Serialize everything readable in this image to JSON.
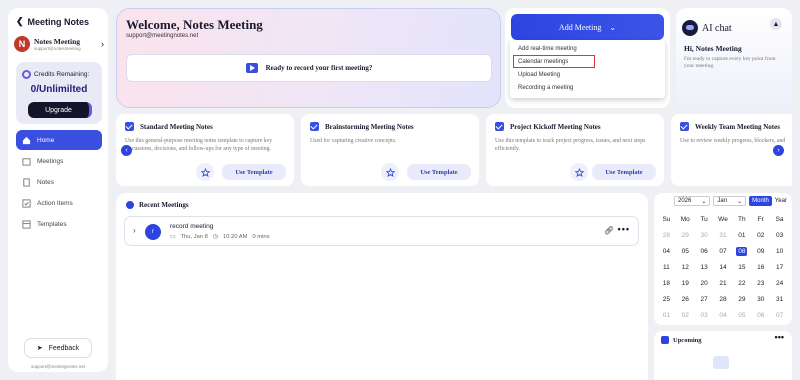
{
  "sidebar": {
    "title": "Meeting Notes",
    "user": {
      "initial": "N",
      "name": "Notes Meeting",
      "email": "support@notesmeeting"
    },
    "credits_label": "Credits Remaining:",
    "credits_value": "0/Unlimilted",
    "upgrade_label": "Upgrade",
    "nav": [
      {
        "label": "Home",
        "icon": "home-icon",
        "active": true
      },
      {
        "label": "Meetings",
        "icon": "calendar-icon",
        "active": false
      },
      {
        "label": "Notes",
        "icon": "notes-icon",
        "active": false
      },
      {
        "label": "Action Items",
        "icon": "checklist-icon",
        "active": false
      },
      {
        "label": "Templates",
        "icon": "templates-icon",
        "active": false
      }
    ],
    "feedback_label": "Feedback",
    "footer_email": "support@meetingnotes.net"
  },
  "welcome": {
    "title": "Welcome, Notes Meeting",
    "email": "support@meetingnotes.net",
    "record_prompt": "Ready to record your first meeting?"
  },
  "add_meeting": {
    "label": "Add Meeting",
    "menu": [
      "Add real-time meeting",
      "Calendar meetings",
      "Upload Meeting",
      "Recording a meeting"
    ],
    "highlighted_index": 1
  },
  "ai_chat": {
    "title": "AI chat",
    "greeting": "Hi, Notes Meeting",
    "description": "I'm ready to capture every key point from your meeting."
  },
  "templates": [
    {
      "title": "Standard Meeting Notes",
      "desc": "Use this general-purpose meeting notes template to capture key discussions, decisions, and follow-ups for any type of meeting.",
      "use": "Use Template"
    },
    {
      "title": "Brainstorming Meeting Notes",
      "desc": "Used for capturing creative concepts.",
      "use": "Use Template"
    },
    {
      "title": "Project Kickoff Meeting Notes",
      "desc": "Use this template to track project progress, issues, and next steps efficiently.",
      "use": "Use Template"
    },
    {
      "title": "Weekly Team Meeting Notes",
      "desc": "Use to review weekly progress, blockers, and",
      "use": "Use Template"
    }
  ],
  "recent": {
    "title": "Recent Meetings",
    "meetings": [
      {
        "avatar": "r",
        "title": "record meeting",
        "date": "Thu, Jan 8",
        "time": "10:20 AM",
        "duration": "0 mins"
      }
    ]
  },
  "calendar": {
    "year": "2026",
    "month": "Jan",
    "view_month": "Month",
    "view_year": "Year",
    "weekdays": [
      "Su",
      "Mo",
      "Tu",
      "We",
      "Th",
      "Fr",
      "Sa"
    ],
    "days": [
      {
        "d": "28",
        "o": true
      },
      {
        "d": "29",
        "o": true
      },
      {
        "d": "30",
        "o": true
      },
      {
        "d": "31",
        "o": true
      },
      {
        "d": "01"
      },
      {
        "d": "02"
      },
      {
        "d": "03"
      },
      {
        "d": "04"
      },
      {
        "d": "05"
      },
      {
        "d": "06"
      },
      {
        "d": "07"
      },
      {
        "d": "08",
        "t": true
      },
      {
        "d": "09"
      },
      {
        "d": "10"
      },
      {
        "d": "11"
      },
      {
        "d": "12"
      },
      {
        "d": "13"
      },
      {
        "d": "14"
      },
      {
        "d": "15"
      },
      {
        "d": "16"
      },
      {
        "d": "17"
      },
      {
        "d": "18"
      },
      {
        "d": "19"
      },
      {
        "d": "20"
      },
      {
        "d": "21"
      },
      {
        "d": "22"
      },
      {
        "d": "23"
      },
      {
        "d": "24"
      },
      {
        "d": "25"
      },
      {
        "d": "26"
      },
      {
        "d": "27"
      },
      {
        "d": "28"
      },
      {
        "d": "29"
      },
      {
        "d": "30"
      },
      {
        "d": "31"
      },
      {
        "d": "01",
        "o": true
      },
      {
        "d": "02",
        "o": true
      },
      {
        "d": "03",
        "o": true
      },
      {
        "d": "04",
        "o": true
      },
      {
        "d": "05",
        "o": true
      },
      {
        "d": "06",
        "o": true
      },
      {
        "d": "07",
        "o": true
      }
    ]
  },
  "upcoming": {
    "title": "Upcoming"
  },
  "colors": {
    "accent": "#2c45e0",
    "highlight": "#d9363e",
    "dark": "#14142b"
  }
}
